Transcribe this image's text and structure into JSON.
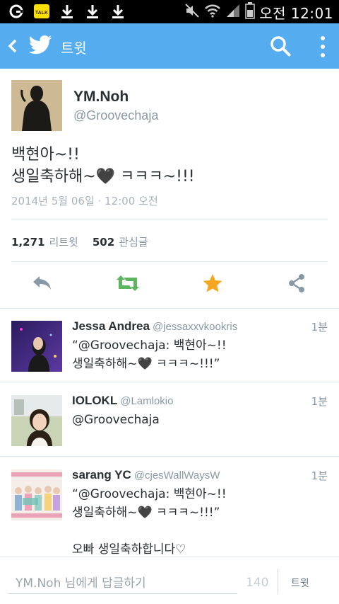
{
  "status_bar": {
    "time": "오전 12:01",
    "icons": [
      "notification-g-icon",
      "kakaotalk-icon",
      "download-icon",
      "download-icon",
      "download-icon",
      "mute-icon",
      "wifi-icon",
      "signal-icon",
      "battery-icon"
    ]
  },
  "action_bar": {
    "title": "트윗",
    "color": "#55ACEE"
  },
  "tweet": {
    "author_name": "YM.Noh",
    "author_handle": "@Groovechaja",
    "text_line1": "백현아~!!",
    "text_line2": "생일축하해~🖤 ㅋㅋㅋ~!!!",
    "date": "2014년 5월 06일 · 12:00 오전",
    "retweets_count": "1,271",
    "retweets_label": "리트윗",
    "favorites_count": "502",
    "favorites_label": "관심글"
  },
  "replies": [
    {
      "name": "Jessa Andrea",
      "handle": "@jessaxxvkookris",
      "time": "1분",
      "text": "“@Groovechaja: 백현아~!!\n생일축하해~🖤 ㅋㅋㅋ~!!!”"
    },
    {
      "name": "IOLOKL",
      "handle": "@Lamlokio",
      "time": "1분",
      "text": "@Groovechaja"
    },
    {
      "name": "sarang YC",
      "handle": "@cjesWallWaysW",
      "time": "1분",
      "text": "“@Groovechaja: 백현아~!!\n생일축하해~🖤 ㅋㅋㅋ~!!!”\n\n오빠 생일축하합니다♡"
    }
  ],
  "composer": {
    "placeholder": "YM.Noh 님에게 답글하기",
    "char_count": "140",
    "send_label": "트윗"
  }
}
